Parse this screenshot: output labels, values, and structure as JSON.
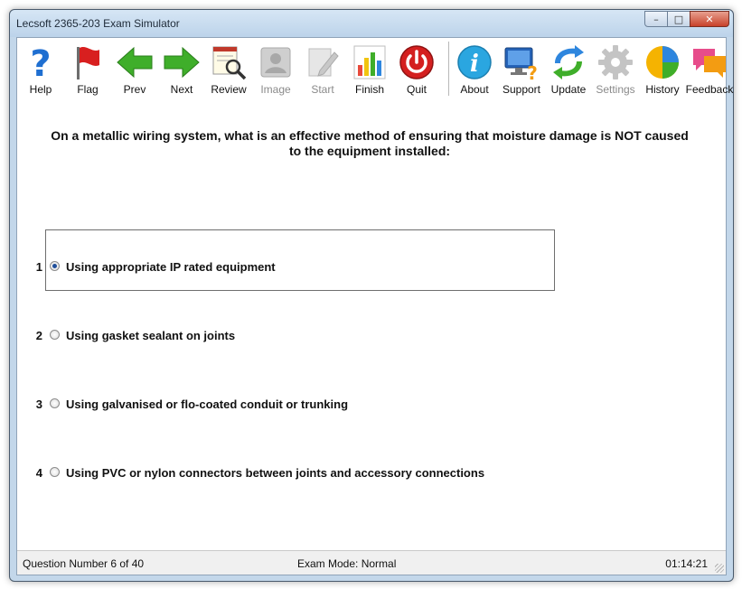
{
  "window": {
    "title": "Lecsoft 2365-203 Exam Simulator",
    "controls": {
      "minimize": "–",
      "maximize": "□",
      "close": "✕"
    }
  },
  "toolbar": {
    "help": "Help",
    "flag": "Flag",
    "prev": "Prev",
    "next": "Next",
    "review": "Review",
    "image": "Image",
    "start": "Start",
    "finish": "Finish",
    "quit": "Quit",
    "about": "About",
    "support": "Support",
    "update": "Update",
    "settings": "Settings",
    "history": "History",
    "feedback": "Feedback"
  },
  "question": {
    "text": "On a metallic wiring system, what is an effective method of ensuring that moisture damage is NOT caused to the equipment installed:"
  },
  "answers": [
    {
      "number": "1",
      "text": "Using appropriate IP rated equipment",
      "selected": true
    },
    {
      "number": "2",
      "text": "Using gasket sealant on joints",
      "selected": false
    },
    {
      "number": "3",
      "text": "Using galvanised or flo-coated conduit or trunking",
      "selected": false
    },
    {
      "number": "4",
      "text": "Using PVC or nylon connectors between joints and accessory connections",
      "selected": false
    }
  ],
  "status": {
    "question_number": "Question Number 6 of 40",
    "mode": "Exam Mode: Normal",
    "timer": "01:14:21"
  },
  "colors": {
    "frame": "#c3d7ea",
    "help_blue": "#1f6fd1",
    "flag_red": "#d81f1f",
    "arrow_green": "#3fae2a",
    "quit_red": "#d42020",
    "radio_dot": "#1f4e9a"
  }
}
